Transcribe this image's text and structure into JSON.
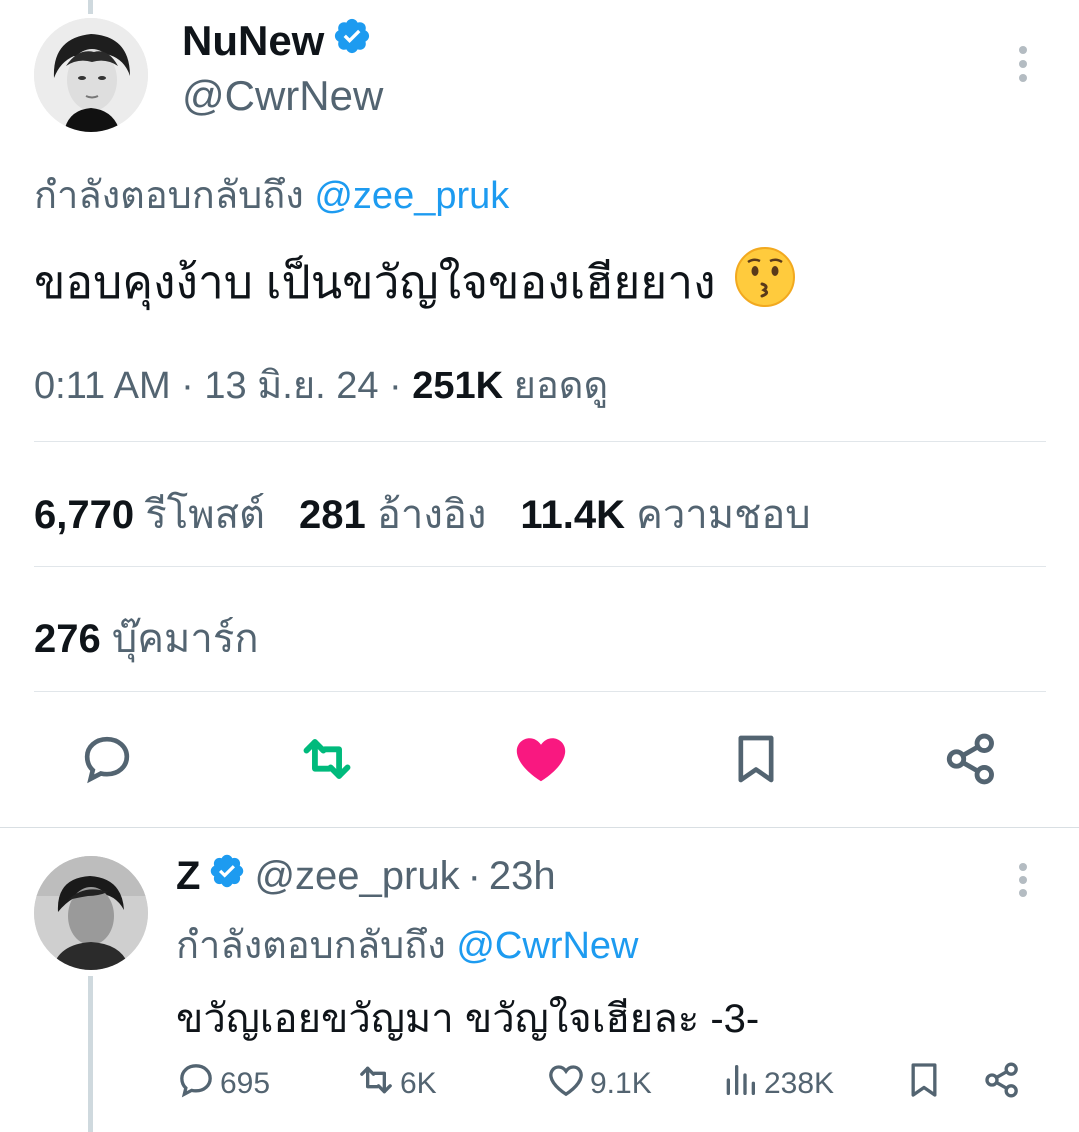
{
  "tweet": {
    "author_name": "NuNew",
    "author_handle": "@CwrNew",
    "replying_prefix": "กำลังตอบกลับถึง",
    "replying_to": "@zee_pruk",
    "text": "ขอบคุงง้าบ เป็นขวัญใจของเฮียยาง",
    "emoji": "😗",
    "time": "0:11 AM",
    "date": "13 มิ.ย. 24",
    "views_count": "251K",
    "views_label": "ยอดดู",
    "reposts_count": "6,770",
    "reposts_label": "รีโพสต์",
    "quotes_count": "281",
    "quotes_label": "อ้างอิง",
    "likes_count": "11.4K",
    "likes_label": "ความชอบ",
    "bookmarks_count": "276",
    "bookmarks_label": "บุ๊คมาร์ก"
  },
  "reply": {
    "author_name": "Z",
    "author_handle": "@zee_pruk",
    "time_ago": "23h",
    "replying_prefix": "กำลังตอบกลับถึง",
    "replying_to": "@CwrNew",
    "text": "ขวัญเอยขวัญมา ขวัญใจเฮียละ -3-",
    "replies": "695",
    "reposts": "6K",
    "likes": "9.1K",
    "views": "238K"
  },
  "colors": {
    "accent": "#1d9bf0",
    "repost_active": "#00ba7c",
    "like_active": "#f91880",
    "secondary_text": "#536471"
  },
  "icons": {
    "verified": "verified-badge-icon",
    "more": "more-vertical-icon",
    "reply": "reply-icon",
    "repost": "repost-icon",
    "like": "heart-icon",
    "bookmark": "bookmark-icon",
    "share": "share-icon",
    "views": "views-icon"
  }
}
